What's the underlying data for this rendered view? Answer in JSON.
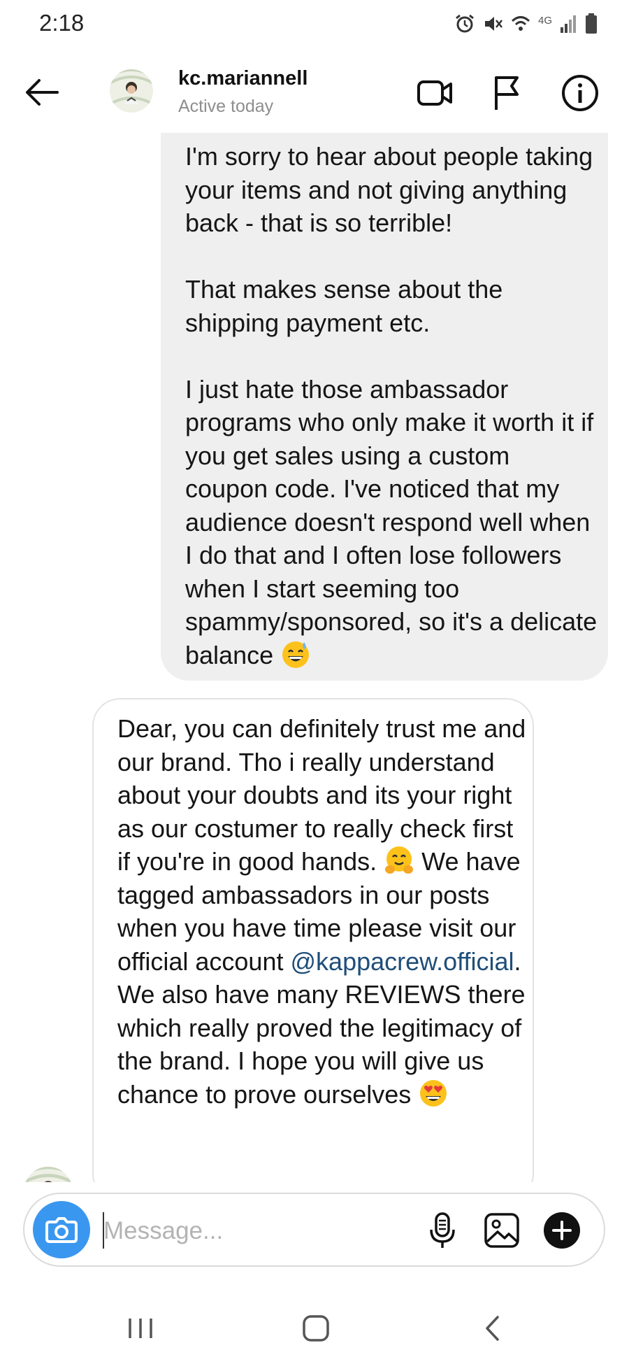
{
  "status": {
    "time": "2:18",
    "network": "4G"
  },
  "header": {
    "username": "kc.mariannell",
    "activity": "Active today",
    "icons": [
      "back-arrow-icon",
      "video-call-icon",
      "flag-icon",
      "info-icon"
    ]
  },
  "messages": [
    {
      "sender": "kc.mariannell",
      "paragraphs": [
        "I'm sorry to hear about people taking your items and not giving anything back - that is so terrible!",
        "That makes sense about the shipping payment etc.",
        "I just hate those ambassador programs who only make it worth it if you get sales using a custom coupon code. I've noticed that my audience doesn't respond well when I do that and I often lose followers when I start seeming too spammy/sponsored, so it's a delicate balance"
      ],
      "trailing_emoji": "grinning-sweat-emoji"
    },
    {
      "sender": "me",
      "part1": "Dear, you can definitely trust me and our brand. Tho i really understand about your doubts and its your right as our costumer to really check first if you're in good hands.",
      "emoji1": "hugging-face-emoji",
      "part2": "We have tagged ambassadors in our posts when you have time please visit our official account",
      "mention": "@kappacrew.official",
      "part3": ". We also have many REVIEWS there which really proved the legitimacy of the brand. I hope you will give us chance to prove ourselves",
      "emoji2": "heart-eyes-emoji"
    }
  ],
  "composer": {
    "placeholder": "Message...",
    "value": "",
    "icons": [
      "camera-icon",
      "microphone-icon",
      "gallery-icon",
      "plus-icon"
    ]
  },
  "colors": {
    "camera_button": "#3a97f0",
    "mention": "#1f4e79",
    "incoming_bubble": "#efefef"
  },
  "navbar": {
    "icons": [
      "recent-apps-icon",
      "home-icon",
      "back-icon"
    ]
  }
}
